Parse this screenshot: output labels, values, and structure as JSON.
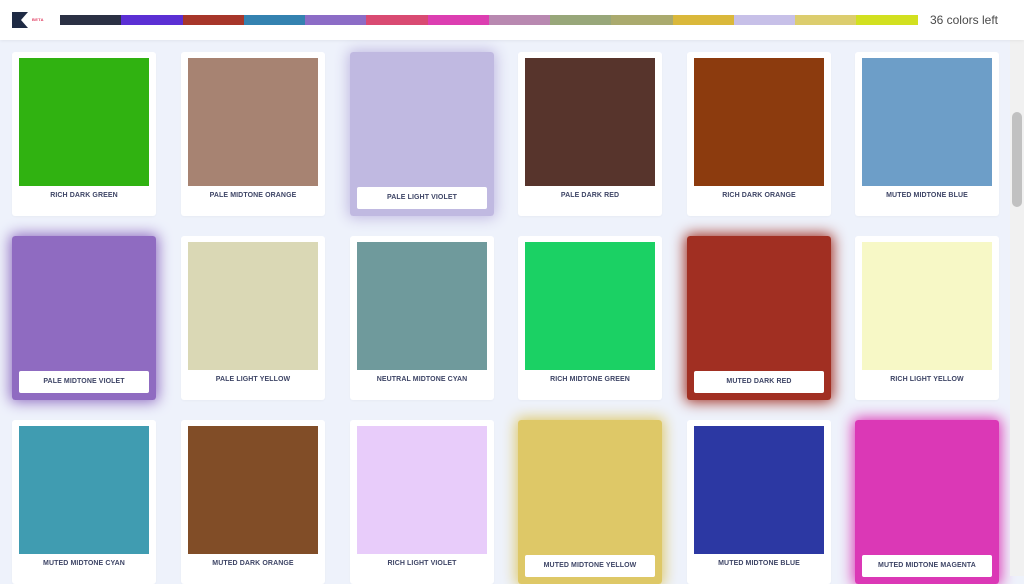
{
  "header": {
    "beta_label": "BETA",
    "colors_left": "36 colors left",
    "swatches": [
      "#2b3044",
      "#5b2fd4",
      "#a7362a",
      "#3482b0",
      "#8c6cc6",
      "#d94a72",
      "#dc3eb1",
      "#b888b0",
      "#98a77a",
      "#aaaa6e",
      "#dab83b",
      "#c7c0e8",
      "#dccd6e",
      "#d2e020"
    ]
  },
  "cards": [
    {
      "label": "RICH DARK GREEN",
      "color": "#30b211",
      "selected": false
    },
    {
      "label": "PALE MIDTONE ORANGE",
      "color": "#a78372",
      "selected": false
    },
    {
      "label": "PALE LIGHT VIOLET",
      "color": "#c0b9e1",
      "selected": true
    },
    {
      "label": "PALE DARK RED",
      "color": "#57342c",
      "selected": false
    },
    {
      "label": "RICH DARK ORANGE",
      "color": "#8c3b0e",
      "selected": false
    },
    {
      "label": "MUTED MIDTONE BLUE",
      "color": "#6d9ec8",
      "selected": false
    },
    {
      "label": "PALE MIDTONE VIOLET",
      "color": "#8f6bc1",
      "selected": true
    },
    {
      "label": "PALE LIGHT YELLOW",
      "color": "#dad8b5",
      "selected": false
    },
    {
      "label": "NEUTRAL MIDTONE CYAN",
      "color": "#6f9a9c",
      "selected": false
    },
    {
      "label": "RICH MIDTONE GREEN",
      "color": "#1bd164",
      "selected": false
    },
    {
      "label": "MUTED DARK RED",
      "color": "#a12f22",
      "selected": true
    },
    {
      "label": "RICH LIGHT YELLOW",
      "color": "#f7f8c6",
      "selected": false
    },
    {
      "label": "MUTED MIDTONE CYAN",
      "color": "#409cb1",
      "selected": false
    },
    {
      "label": "MUTED DARK ORANGE",
      "color": "#814d27",
      "selected": false
    },
    {
      "label": "RICH LIGHT VIOLET",
      "color": "#e8ccfa",
      "selected": false
    },
    {
      "label": "MUTED MIDTONE YELLOW",
      "color": "#dec867",
      "selected": true
    },
    {
      "label": "MUTED MIDTONE BLUE",
      "color": "#2c38a3",
      "selected": false
    },
    {
      "label": "MUTED MIDTONE MAGENTA",
      "color": "#db38b6",
      "selected": true
    }
  ]
}
